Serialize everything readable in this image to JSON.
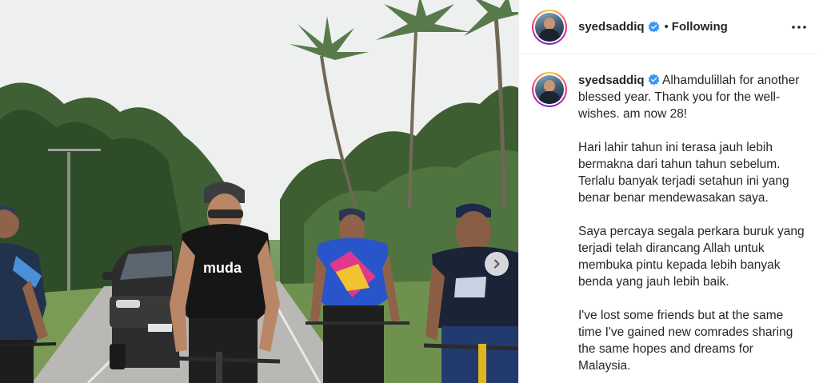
{
  "post": {
    "username": "syedsaddiq",
    "follow_separator": "•",
    "follow_status": "Following",
    "more_icon": "ellipsis-icon",
    "verified_icon": "verified-badge-icon",
    "verified_color": "#3897f0"
  },
  "photo": {
    "description_icon": "cyclists-photo",
    "shirt_text": "muda",
    "next_icon": "chevron-right-icon"
  },
  "caption": {
    "username": "syedsaddiq",
    "first_line": "Alhamdulillah for another blessed year. Thank you for the well-wishes. am now 28!",
    "paragraph_2": "Hari lahir tahun ini terasa jauh lebih bermakna dari tahun tahun sebelum. Terlalu banyak terjadi setahun ini yang benar benar mendewasakan saya.",
    "paragraph_3": "Saya percaya segala perkara buruk yang terjadi telah dirancang Allah untuk membuka pintu kepada lebih banyak benda yang jauh lebih baik.",
    "paragraph_4": "I've lost some friends but at the same time I've gained new comrades sharing the same hopes and dreams for Malaysia."
  }
}
